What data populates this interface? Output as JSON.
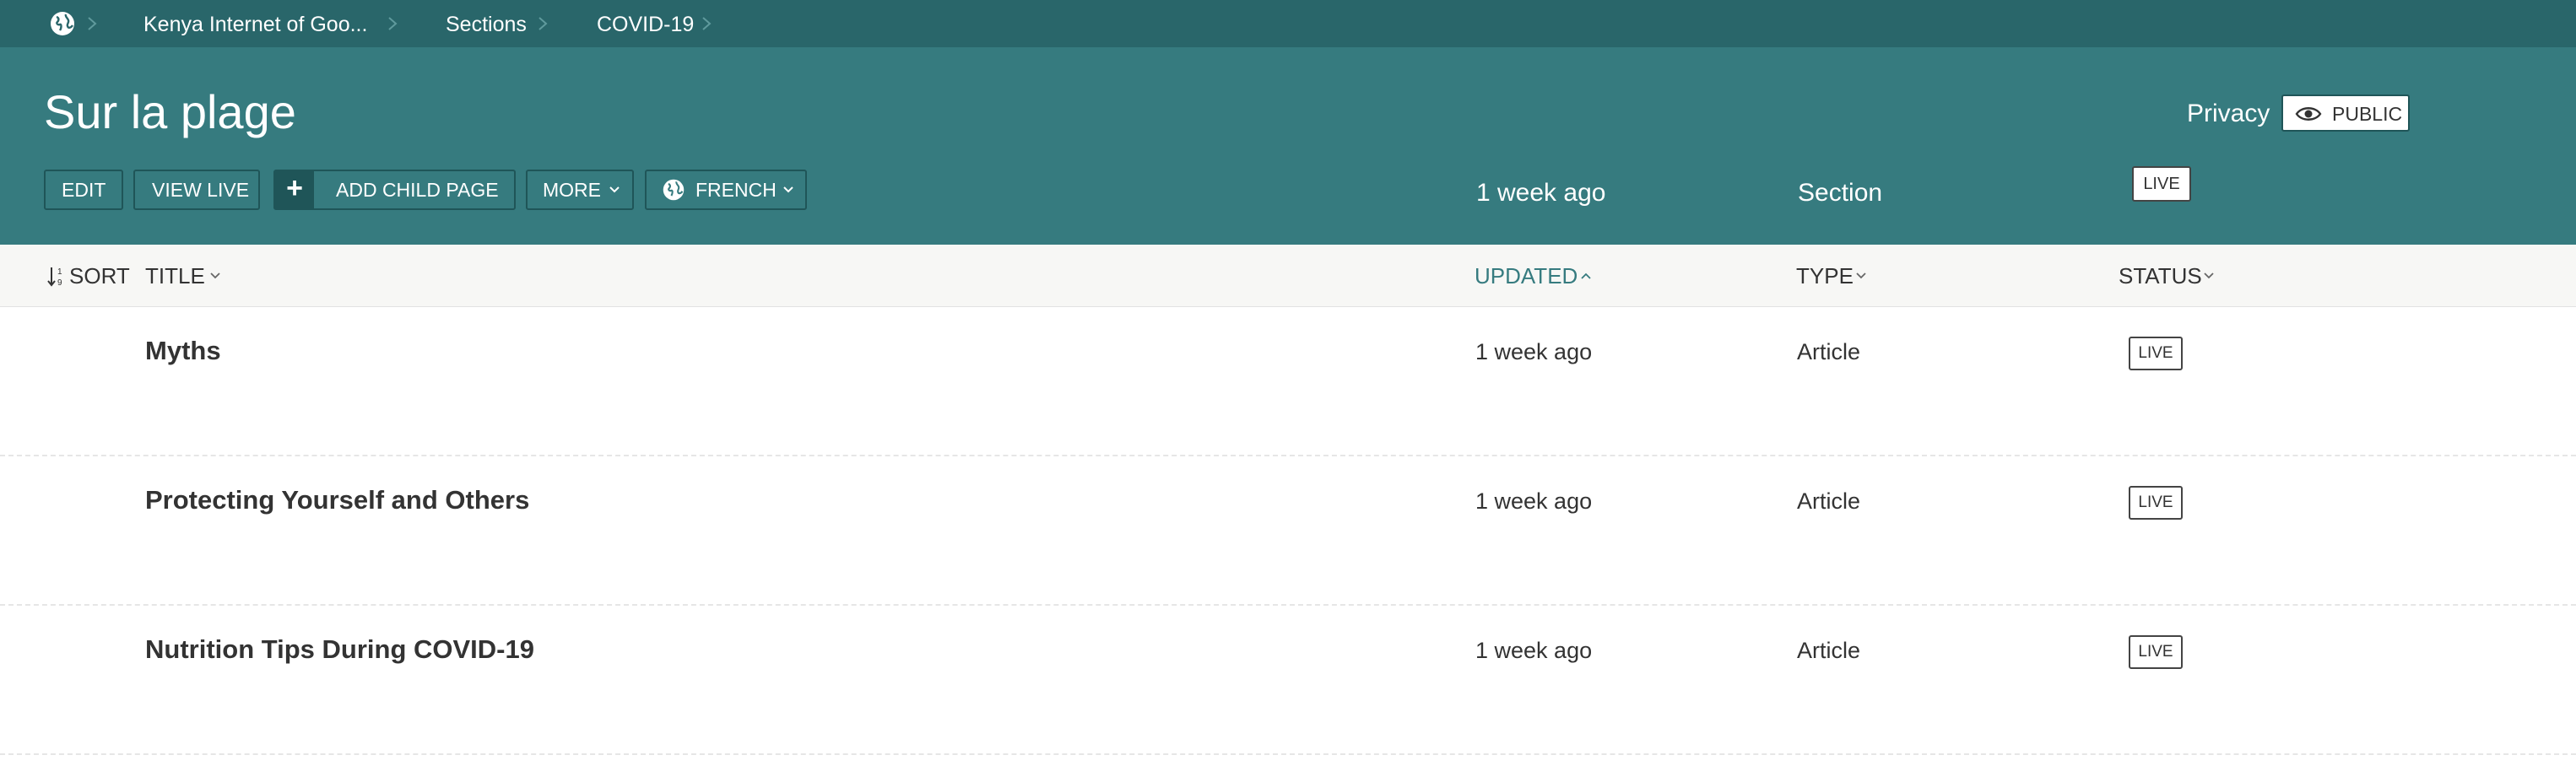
{
  "breadcrumb": {
    "home_icon": "globe-icon",
    "items": [
      {
        "label": "Kenya Internet of Goo..."
      },
      {
        "label": "Sections"
      },
      {
        "label": "COVID-19"
      }
    ]
  },
  "header": {
    "title": "Sur la plage",
    "privacy_label": "Privacy",
    "privacy_value": "PUBLIC",
    "privacy_icon": "eye-icon",
    "buttons": {
      "edit": "EDIT",
      "view_live": "VIEW LIVE",
      "add_child_page": "ADD CHILD PAGE",
      "more": "MORE",
      "language": "FRENCH"
    },
    "updated": "1 week ago",
    "type": "Section",
    "status": "LIVE"
  },
  "table": {
    "columns": {
      "sort": "SORT",
      "title": "TITLE",
      "updated": "UPDATED",
      "type": "TYPE",
      "status": "STATUS"
    },
    "rows": [
      {
        "title": "Myths",
        "updated": "1 week ago",
        "type": "Article",
        "status": "LIVE"
      },
      {
        "title": "Protecting Yourself and Others",
        "updated": "1 week ago",
        "type": "Article",
        "status": "LIVE"
      },
      {
        "title": "Nutrition Tips During COVID-19",
        "updated": "1 week ago",
        "type": "Article",
        "status": "LIVE"
      }
    ]
  },
  "colors": {
    "breadcrumb_bg": "#29666a",
    "header_bg": "#367b7f",
    "accent": "#367b7f",
    "button_border": "#1f5558"
  }
}
